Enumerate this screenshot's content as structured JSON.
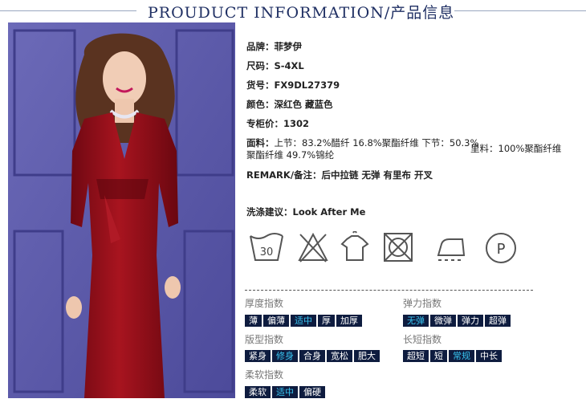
{
  "header": {
    "title": "PROUDUCT INFORMATION/产品信息"
  },
  "info": {
    "brand": "品牌：菲梦伊",
    "size": "尺码：S-4XL",
    "item_no": "货号：FX9DL27379",
    "color": "颜色：深红色   藏蓝色",
    "price": "专柜价：1302",
    "fabric_label": "面料：",
    "fabric_line1": "上节：83.2%醋纤 16.8%聚酯纤维   下节：50.3%",
    "fabric_line2": "聚酯纤维 49.7%锦纶",
    "lining": "里料：100%聚酯纤维",
    "remark_label": "REMARK/备注：",
    "remark_value": "后中拉链 无弹 有里布 开叉",
    "wash_label": "洗涤建议：",
    "wash_value": "Look After Me"
  },
  "care_icons": [
    "wash-30",
    "no-bleach",
    "hang-dry",
    "no-tumble-dry",
    "iron",
    "dry-clean-P"
  ],
  "care_text": {
    "wash_temp": "30",
    "dry_clean": "P"
  },
  "indices": {
    "thickness": {
      "title": "厚度指数",
      "options": [
        "薄",
        "偏薄",
        "适中",
        "厚",
        "加厚"
      ],
      "selected": "适中"
    },
    "elasticity": {
      "title": "弹力指数",
      "options": [
        "无弹",
        "微弹",
        "弹力",
        "超弹"
      ],
      "selected": "无弹"
    },
    "fit": {
      "title": "版型指数",
      "options": [
        "紧身",
        "修身",
        "合身",
        "宽松",
        "肥大"
      ],
      "selected": "修身"
    },
    "length": {
      "title": "长短指数",
      "options": [
        "超短",
        "短",
        "常规",
        "中长"
      ],
      "selected": "常规"
    },
    "softness": {
      "title": "柔软指数",
      "options": [
        "柔软",
        "适中",
        "偏硬"
      ],
      "selected": "适中"
    }
  },
  "colors": {
    "navy": "#0e1c3f",
    "active": "#38c4f0",
    "dress": "#8e0d17",
    "backdrop": "#5a58a8"
  }
}
